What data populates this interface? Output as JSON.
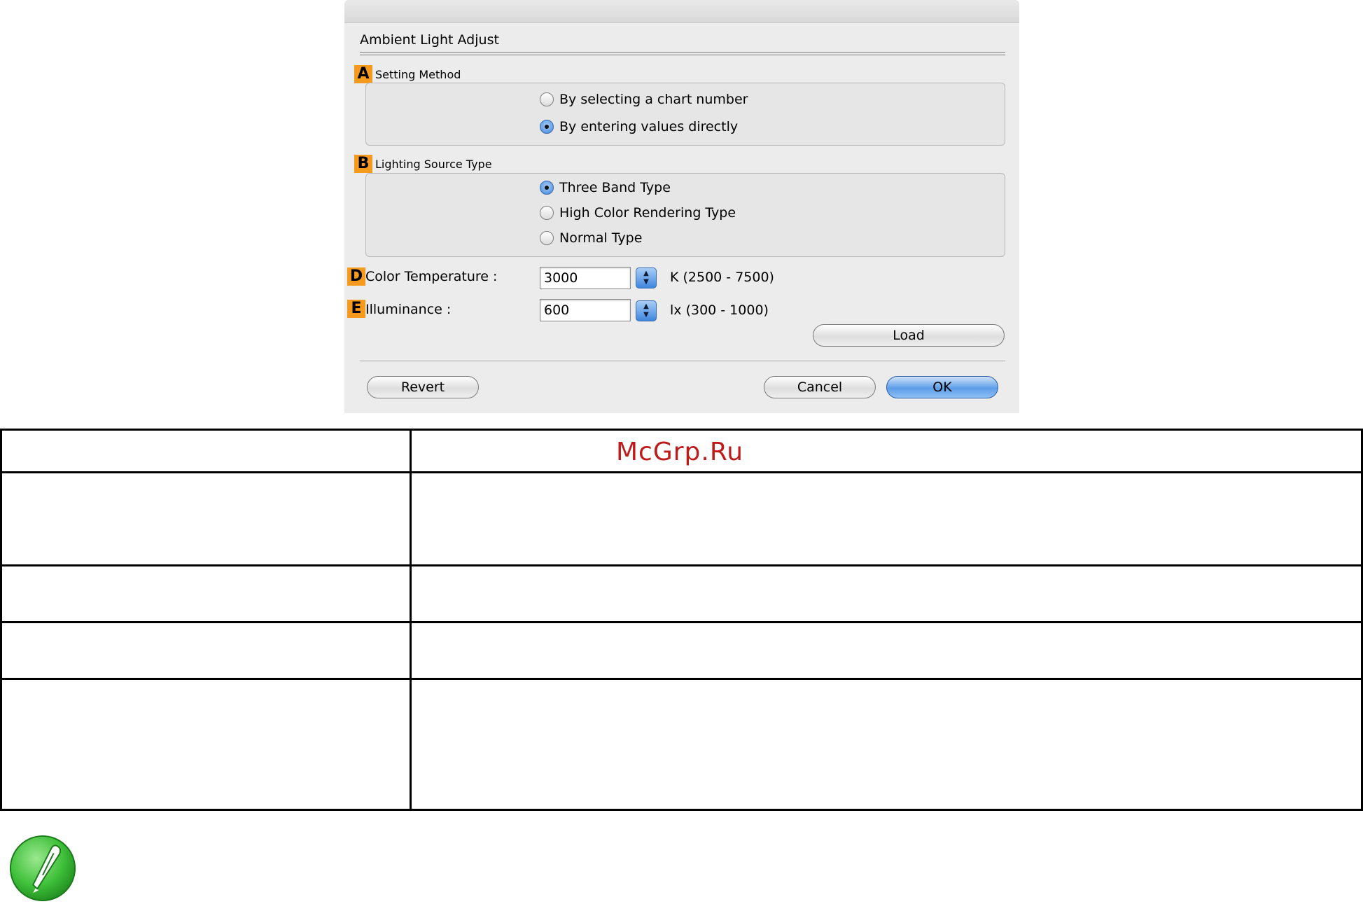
{
  "dialog": {
    "title": "Ambient Light Adjust",
    "setting_method": {
      "marker": "A",
      "label": "Setting Method",
      "options": [
        "By selecting a chart number",
        "By entering values directly"
      ],
      "selected_index": 1
    },
    "lighting_source": {
      "marker": "B",
      "label": "Lighting Source Type",
      "options": [
        "Three Band Type",
        "High Color Rendering Type",
        "Normal Type"
      ],
      "selected_index": 0
    },
    "color_temperature": {
      "marker": "D",
      "label": "Color Temperature :",
      "value": "3000",
      "range": "K (2500 - 7500)"
    },
    "illuminance": {
      "marker": "E",
      "label": "Illuminance :",
      "value": "600",
      "range": "lx (300 - 1000)"
    },
    "buttons": {
      "load": "Load",
      "revert": "Revert",
      "cancel": "Cancel",
      "ok": "OK"
    }
  },
  "watermark": "McGrp.Ru",
  "colors": {
    "marker": "#f59a1c",
    "accent_blue": "#3f86de",
    "watermark": "#c11a1a",
    "note_green": "#3fc03a"
  },
  "icons": {
    "note": "pencil-note-icon"
  }
}
